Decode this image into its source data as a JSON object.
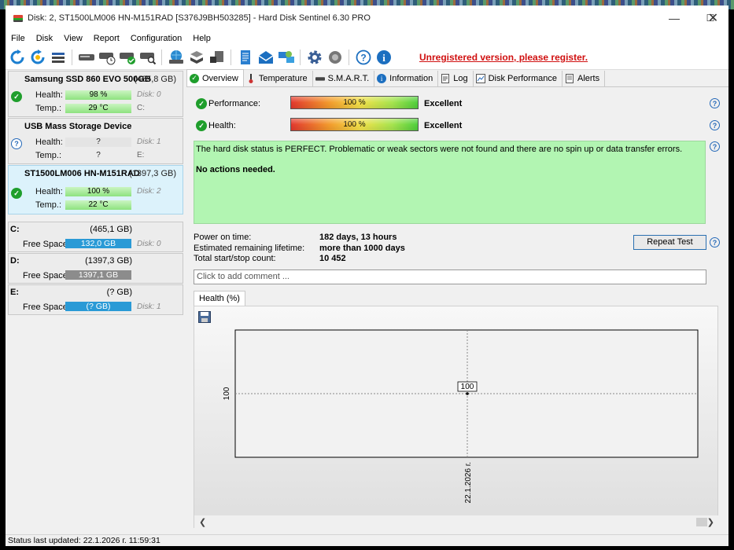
{
  "window": {
    "title": "Disk: 2, ST1500LM006 HN-M151RAD [S376J9BH503285]  -  Hard Disk Sentinel 6.30 PRO"
  },
  "menu": [
    "File",
    "Disk",
    "View",
    "Report",
    "Configuration",
    "Help"
  ],
  "toolbar": {
    "icons": [
      "refresh-icon",
      "refresh-all-icon",
      "list-icon",
      "disk-icon",
      "disk-clock-icon",
      "disk-check-icon",
      "disk-search-icon",
      "globe-disk-icon",
      "disk-stack-icon",
      "disk-export-icon",
      "report-icon",
      "mail-icon",
      "network-icon",
      "gear-icon",
      "speaker-icon",
      "help-icon",
      "info-icon"
    ],
    "unregistered_text": "Unregistered version, please register."
  },
  "disks": [
    {
      "name": "Samsung SSD 860 EVO 500GB",
      "size": "(465,8 GB)",
      "status": "ok",
      "health_label": "Health:",
      "health": "98 %",
      "disk_label": "Disk: 0",
      "temp_label": "Temp.:",
      "temp": "29 °C",
      "drive": "C:"
    },
    {
      "name": "USB Mass Storage Device",
      "size": "",
      "status": "unknown",
      "health_label": "Health:",
      "health": "?",
      "disk_label": "Disk: 1",
      "temp_label": "Temp.:",
      "temp": "?",
      "drive": "E:"
    },
    {
      "name": "ST1500LM006 HN-M151RAD",
      "size": "(1397,3 GB)",
      "status": "ok",
      "health_label": "Health:",
      "health": "100 %",
      "disk_label": "Disk: 2",
      "temp_label": "Temp.:",
      "temp": "22 °C",
      "drive": ""
    }
  ],
  "volumes": [
    {
      "letter": "C:",
      "size": "(465,1 GB)",
      "free_label": "Free Space",
      "free": "132,0 GB",
      "disk": "Disk: 0",
      "bar_color": "#2a9ad6",
      "fill": 0.28
    },
    {
      "letter": "D:",
      "size": "(1397,3 GB)",
      "free_label": "Free Space",
      "free": "1397,1 GB",
      "disk": "",
      "bar_color": "#8c8c8c",
      "fill": 1.0
    },
    {
      "letter": "E:",
      "size": "(? GB)",
      "free_label": "Free Space",
      "free": "(? GB)",
      "disk": "Disk: 1",
      "bar_color": "#2a9ad6",
      "fill": 1.0
    }
  ],
  "tabs": [
    "Overview",
    "Temperature",
    "S.M.A.R.T.",
    "Information",
    "Log",
    "Disk Performance",
    "Alerts"
  ],
  "overview": {
    "performance_label": "Performance:",
    "performance_value": "100 %",
    "performance_rating": "Excellent",
    "health_label": "Health:",
    "health_value": "100 %",
    "health_rating": "Excellent",
    "status_text": "The hard disk status is PERFECT. Problematic or weak sectors were not found and there are no spin up or data transfer errors.",
    "action_text": "No actions needed.",
    "power_on_label": "Power on time:",
    "power_on_value": "182 days, 13 hours",
    "lifetime_label": "Estimated remaining lifetime:",
    "lifetime_value": "more than 1000 days",
    "startstop_label": "Total start/stop count:",
    "startstop_value": "10 452",
    "repeat_test": "Repeat Test",
    "comment_placeholder": "Click to add comment ..."
  },
  "chart_tab": "Health (%)",
  "chart_data": {
    "type": "line",
    "x": [
      "22.1.2026 г."
    ],
    "series": [
      {
        "values": [
          100
        ]
      }
    ],
    "y_tick": "100",
    "data_label": "100",
    "xlabel": "",
    "ylabel": ""
  },
  "statusbar": "Status last updated: 22.1.2026 г. 11:59:31"
}
